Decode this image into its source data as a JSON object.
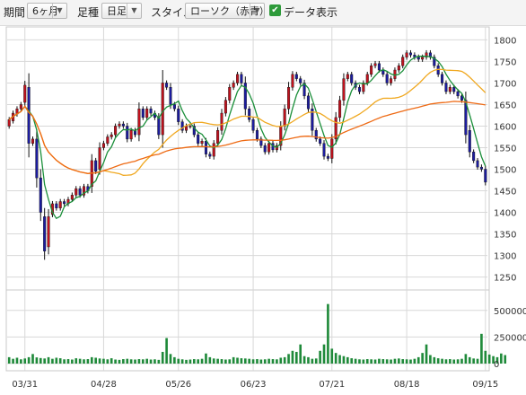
{
  "toolbar": {
    "period_label": "期間",
    "period_value": "6ヶ月",
    "foot_label": "足種",
    "foot_value": "日足",
    "style_label": "スタイル",
    "style_value": "ローソク（赤青）",
    "data_display_label": "データ表示",
    "data_display_checked": true
  },
  "colors": {
    "up_candle": "#c0121e",
    "down_candle": "#1c1c9e",
    "ma_short": "#1b8f3a",
    "ma_mid": "#f0a820",
    "ma_long": "#ee6a14",
    "volume": "#1f8a3a",
    "grid": "#d8d8d8"
  },
  "chart_data": {
    "type": "candlestick",
    "x_tick_labels": [
      "03/31",
      "04/28",
      "05/26",
      "06/23",
      "07/21",
      "08/18",
      "09/15"
    ],
    "x_tick_indices": [
      4,
      24,
      43,
      62,
      82,
      101,
      121
    ],
    "price_axis": {
      "ticks": [
        1250,
        1300,
        1350,
        1400,
        1450,
        1500,
        1550,
        1600,
        1650,
        1700,
        1750,
        1800
      ],
      "ylim": [
        1220,
        1830
      ]
    },
    "volume_axis": {
      "tick_labels": [
        "500000",
        "250000",
        "0"
      ],
      "ticks": [
        500000,
        250000,
        0
      ],
      "ylim": [
        0,
        650000
      ]
    },
    "closes": [
      1615,
      1630,
      1640,
      1650,
      1695,
      1560,
      1570,
      1480,
      1400,
      1310,
      1390,
      1420,
      1410,
      1425,
      1420,
      1430,
      1440,
      1455,
      1440,
      1460,
      1450,
      1520,
      1495,
      1550,
      1560,
      1575,
      1580,
      1600,
      1605,
      1600,
      1570,
      1590,
      1580,
      1640,
      1620,
      1640,
      1630,
      1620,
      1580,
      1700,
      1690,
      1650,
      1640,
      1610,
      1590,
      1600,
      1600,
      1580,
      1560,
      1565,
      1535,
      1530,
      1560,
      1590,
      1630,
      1660,
      1690,
      1700,
      1720,
      1700,
      1640,
      1615,
      1590,
      1570,
      1555,
      1540,
      1560,
      1545,
      1555,
      1600,
      1640,
      1690,
      1720,
      1710,
      1700,
      1670,
      1640,
      1590,
      1570,
      1560,
      1530,
      1525,
      1570,
      1620,
      1660,
      1710,
      1720,
      1700,
      1690,
      1680,
      1700,
      1720,
      1740,
      1745,
      1730,
      1720,
      1700,
      1710,
      1730,
      1740,
      1760,
      1770,
      1765,
      1760,
      1755,
      1760,
      1770,
      1760,
      1740,
      1720,
      1700,
      1680,
      1690,
      1680,
      1670,
      1660,
      1580,
      1540,
      1520,
      1505,
      1500,
      1470
    ],
    "opens": [
      1600,
      1612,
      1628,
      1640,
      1655,
      1690,
      1560,
      1570,
      1480,
      1390,
      1320,
      1395,
      1420,
      1410,
      1425,
      1420,
      1430,
      1440,
      1455,
      1440,
      1460,
      1460,
      1520,
      1500,
      1550,
      1560,
      1575,
      1580,
      1600,
      1605,
      1600,
      1570,
      1590,
      1580,
      1640,
      1620,
      1640,
      1630,
      1620,
      1580,
      1700,
      1690,
      1650,
      1640,
      1610,
      1590,
      1600,
      1600,
      1580,
      1560,
      1565,
      1535,
      1530,
      1560,
      1590,
      1630,
      1660,
      1690,
      1700,
      1720,
      1700,
      1640,
      1615,
      1590,
      1570,
      1555,
      1540,
      1560,
      1545,
      1555,
      1600,
      1640,
      1690,
      1720,
      1710,
      1700,
      1670,
      1640,
      1590,
      1570,
      1560,
      1530,
      1525,
      1570,
      1620,
      1660,
      1710,
      1720,
      1700,
      1690,
      1680,
      1700,
      1720,
      1740,
      1745,
      1730,
      1720,
      1700,
      1710,
      1730,
      1740,
      1760,
      1770,
      1765,
      1760,
      1755,
      1760,
      1770,
      1760,
      1740,
      1720,
      1700,
      1680,
      1690,
      1680,
      1670,
      1660,
      1590,
      1540,
      1520,
      1505,
      1500
    ],
    "volumes": [
      60000,
      45000,
      55000,
      40000,
      48000,
      60000,
      90000,
      58000,
      52000,
      48000,
      60000,
      45000,
      55000,
      50000,
      40000,
      42000,
      38000,
      50000,
      45000,
      40000,
      42000,
      60000,
      55000,
      48000,
      45000,
      40000,
      50000,
      38000,
      35000,
      42000,
      45000,
      40000,
      38000,
      42000,
      40000,
      45000,
      38000,
      40000,
      35000,
      110000,
      240000,
      90000,
      60000,
      45000,
      40000,
      35000,
      38000,
      42000,
      40000,
      45000,
      95000,
      60000,
      48000,
      45000,
      42000,
      38000,
      40000,
      60000,
      55000,
      50000,
      48000,
      45000,
      40000,
      42000,
      38000,
      40000,
      45000,
      42000,
      40000,
      55000,
      60000,
      90000,
      120000,
      110000,
      180000,
      70000,
      60000,
      45000,
      48000,
      120000,
      180000,
      560000,
      140000,
      100000,
      80000,
      70000,
      60000,
      50000,
      45000,
      40000,
      38000,
      42000,
      40000,
      38000,
      45000,
      42000,
      40000,
      38000,
      45000,
      48000,
      42000,
      40000,
      38000,
      45000,
      60000,
      100000,
      180000,
      80000,
      60000,
      50000,
      45000,
      40000,
      42000,
      38000,
      40000,
      45000,
      90000,
      60000,
      48000,
      45000,
      280000,
      120000,
      85000,
      70000,
      60000,
      95000,
      80000
    ]
  }
}
